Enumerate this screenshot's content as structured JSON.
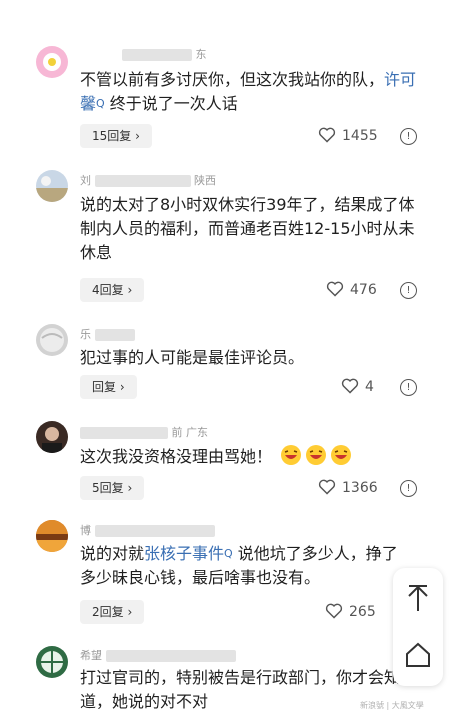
{
  "comments": [
    {
      "meta_text": "东",
      "body_plain": "不管以前有多讨厌你，但这次我站你的队，",
      "link_text": "许可馨",
      "search_glyph": "Q",
      "body_after": " 终于说了一次人话",
      "reply_label": "15回复 ›",
      "likes": "1455"
    },
    {
      "meta_prefix": "刘",
      "meta_text": "陕西",
      "body": "说的太对了8小时双休实行39年了，结果成了体制内人员的福利，而普通老百姓12-15小时从未休息",
      "reply_label": "4回复 ›",
      "likes": "476"
    },
    {
      "meta_prefix": "乐",
      "meta_text": "",
      "body": "犯过事的人可能是最佳评论员。",
      "reply_label": "回复 ›",
      "likes": "4"
    },
    {
      "meta_prefix": "",
      "meta_text": "前  广东",
      "body": "这次我没资格没理由骂她！",
      "reply_label": "5回复 ›",
      "likes": "1366"
    },
    {
      "meta_prefix": "博",
      "meta_text": "",
      "body_before": "说的对就",
      "link_text": "张核子事件",
      "search_glyph": "Q",
      "body_after": " 说他坑了多少人，挣了多少昧良心钱，最后啥事也没有。",
      "reply_label": "2回复 ›",
      "likes": "265"
    },
    {
      "meta_prefix": "希望",
      "meta_text": "",
      "body": "打过官司的，特别被告是行政部门，你才会知道，她说的对不对"
    }
  ],
  "watermark": "新浪號 | 大風文學",
  "colors": {
    "link": "#3a6fb3",
    "emoji": "#ffcc33"
  }
}
